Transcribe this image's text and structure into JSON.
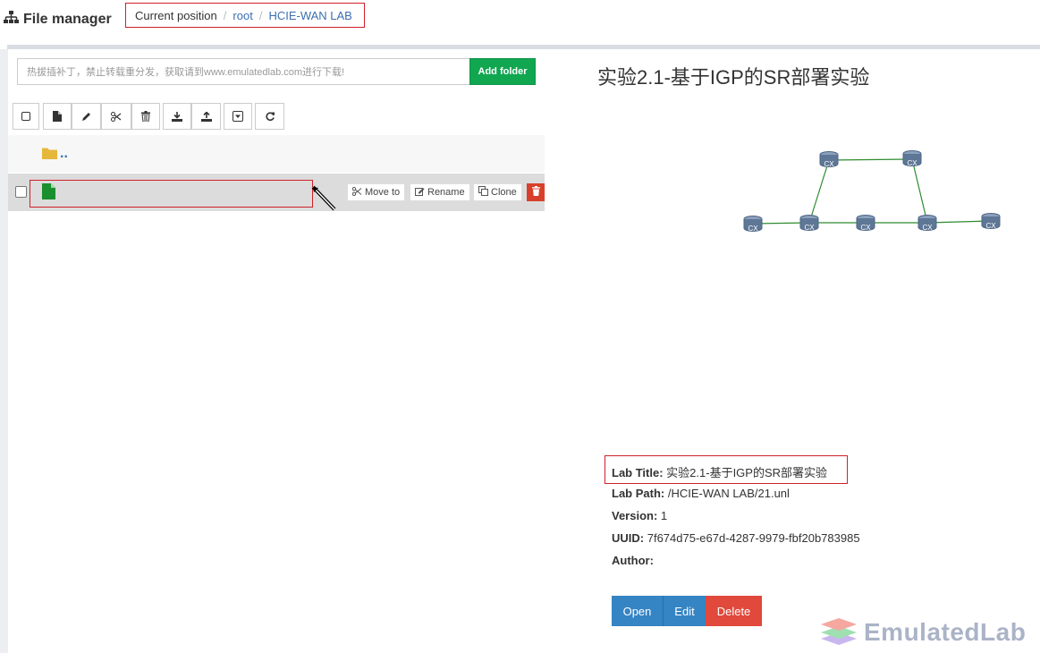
{
  "header": {
    "title": "File manager",
    "breadcrumb": {
      "current_label": "Current position",
      "items": [
        "root",
        "HCIE-WAN LAB"
      ]
    }
  },
  "file_browser": {
    "search_placeholder": "热拔插补丁，禁止转载重分发，获取请到www.emulatedlab.com进行下载!",
    "add_folder_label": "Add folder",
    "parent_dir_label": "..",
    "file_actions": {
      "move_label": "Move to",
      "rename_label": "Rename",
      "clone_label": "Clone"
    }
  },
  "lab": {
    "heading": "实验2.1-基于IGP的SR部署实验",
    "fields": {
      "title_label": "Lab Title:",
      "title_value": "实验2.1-基于IGP的SR部署实验",
      "path_label": "Lab Path:",
      "path_value": "/HCIE-WAN LAB/21.unl",
      "version_label": "Version:",
      "version_value": "1",
      "uuid_label": "UUID:",
      "uuid_value": "7f674d75-e67d-4287-9979-fbf20b783985",
      "author_label": "Author:",
      "author_value": ""
    },
    "buttons": {
      "open": "Open",
      "edit": "Edit",
      "delete": "Delete"
    },
    "topology_node_label": "CX"
  },
  "watermark": "EmulatedLab",
  "colors": {
    "accent_blue": "#3584c4",
    "danger": "#e0493b",
    "success": "#11a650",
    "highlight_border": "#d0202a"
  }
}
